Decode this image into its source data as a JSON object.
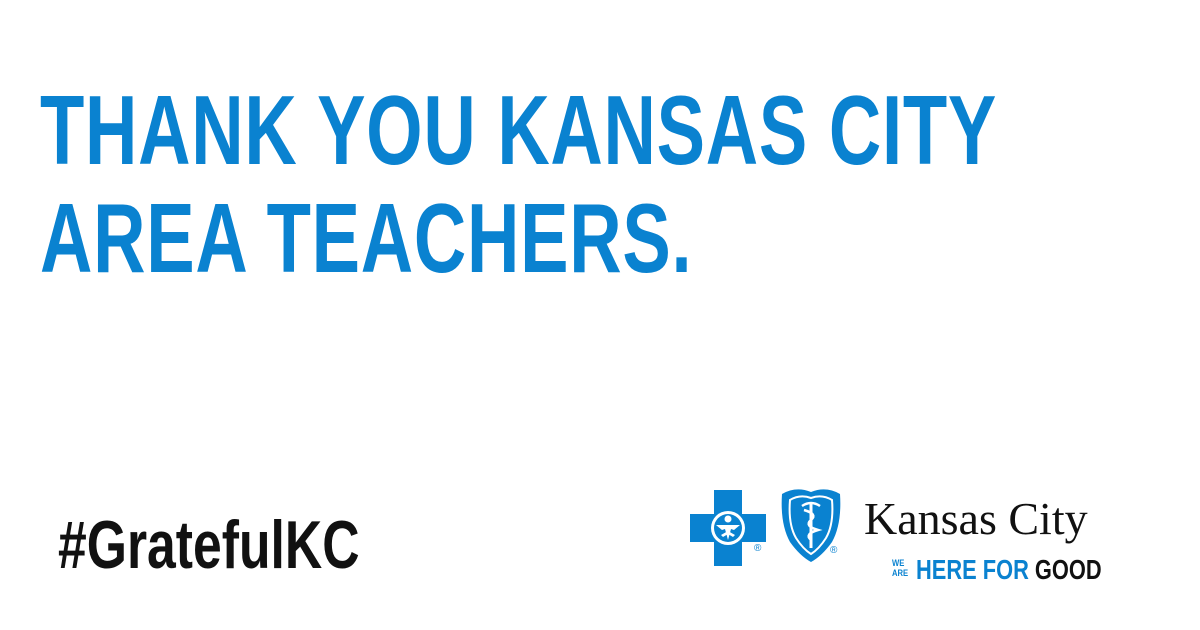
{
  "headline": {
    "line1": "THANK YOU KANSAS CITY",
    "line2": "AREA TEACHERS."
  },
  "hashtag": "#GratefulKC",
  "logo": {
    "cross_icon": "blue-cross-icon",
    "shield_icon": "blue-shield-icon",
    "registered_mark": "®",
    "company_name": "Kansas City",
    "tagline": {
      "small_top": "WE",
      "small_bottom": "ARE",
      "highlight": "HERE FOR",
      "rest": "GOOD"
    }
  },
  "colors": {
    "brand_blue": "#0A82D0",
    "text_black": "#111111",
    "background": "#FFFFFF"
  }
}
